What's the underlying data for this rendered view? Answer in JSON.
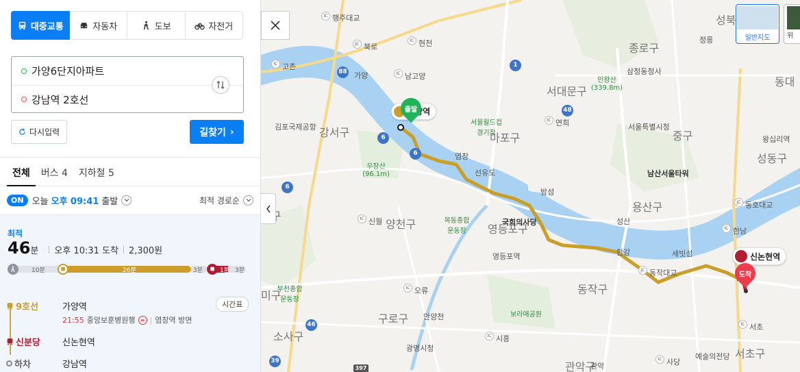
{
  "modes": [
    {
      "label": "대중교통",
      "icon": "bus-icon",
      "active": true
    },
    {
      "label": "자동차",
      "icon": "car-icon",
      "active": false
    },
    {
      "label": "도보",
      "icon": "walk-icon",
      "active": false
    },
    {
      "label": "자전거",
      "icon": "bicycle-icon",
      "active": false
    }
  ],
  "route": {
    "origin": "가양6단지아파트",
    "destination": "강남역 2호선"
  },
  "buttons": {
    "reset": "다시입력",
    "find": "길찾기"
  },
  "tabs": [
    {
      "label": "전체",
      "active": true
    },
    {
      "label": "버스 4",
      "active": false
    },
    {
      "label": "지하철 5",
      "active": false
    }
  ],
  "departure": {
    "on": "ON",
    "prefix": "오늘",
    "time": "오후 09:41",
    "suffix": "출발",
    "sort": "최적 경로순"
  },
  "result": {
    "badge": "최적",
    "minutes": "46",
    "min_unit": "분",
    "arrival": "오후 10:31 도착",
    "fare": "2,300원",
    "segments": {
      "walk1": "10분",
      "bus": "26분",
      "walk2": "3분",
      "subway": "1분",
      "walk3": "3분"
    },
    "steps": [
      {
        "line": "9호선",
        "place": "가양역",
        "color": "#c99e29"
      },
      {
        "line": "신분당",
        "place": "신논현역",
        "color": "#b01e2f"
      },
      {
        "line": "하차",
        "place": "강남역",
        "color": "#888888"
      }
    ],
    "sub_time": "21:55",
    "sub_dir": "중앙보훈병원행",
    "sub_exit": "염창역 방면",
    "timetable": "시간표"
  },
  "map": {
    "districts": [
      "종로구",
      "서대문구",
      "마포구",
      "강서구",
      "양천구",
      "영등포구",
      "용산구",
      "중구",
      "동작구",
      "구로구",
      "소사구",
      "서초구",
      "성북구",
      "동대",
      "성동구",
      "관악구",
      "미구",
      "정구"
    ],
    "places": {
      "gimpo": "김포국제공항",
      "worldcup": "서울월드컵\n경기장",
      "inwang": "인왕산\n(339.8m)",
      "woojang": "우장산\n(96.1m)",
      "mokdong": "목동종합\n운동장",
      "bucheon": "부천종합\n운동장",
      "boramae": "보라매공원",
      "namsan": "남산서울타워",
      "assembly": "국회의사당",
      "samcheong": "삼청동청사",
      "yeongdeungpo": "영등포역",
      "seoulstation": "서울특별시청",
      "gwangmyeong": "광명시청",
      "arts": "예술의전당",
      "jeongneung": "정릉",
      "wangsimni": "왕십리역",
      "seonyu": "선유도",
      "bamseom": "밤섬",
      "seobinggo": "세빗섬",
      "hangang": "한강",
      "anyang": "안양천"
    },
    "ic_labels": [
      "행주대교",
      "북로",
      "현천",
      "고촌",
      "남고양",
      "가양",
      "연희",
      "염창",
      "신월",
      "오류",
      "시흥",
      "동작대교",
      "동호대교",
      "한남",
      "반포",
      "서초",
      "사당",
      "관악",
      "성산"
    ],
    "roads": [
      "88",
      "1",
      "6",
      "48",
      "6",
      "6",
      "46",
      "39",
      "397"
    ],
    "start_station": "가양역",
    "start_pin": "출발",
    "end_station": "신논현역",
    "end_pin": "도착",
    "map_type_label": "일반지도",
    "map_type2_label": "위",
    "route_color": "#c99e29"
  }
}
